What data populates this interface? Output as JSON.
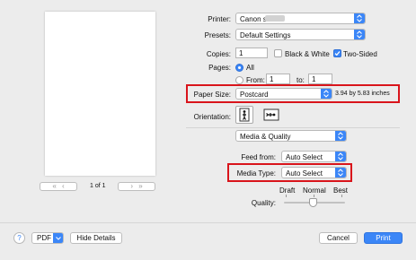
{
  "preview": {
    "page_counter": "1 of 1",
    "first_icon": "double-left-arrow",
    "prev_icon": "left-arrow",
    "next_icon": "right-arrow",
    "last_icon": "double-right-arrow"
  },
  "printer": {
    "label": "Printer:",
    "value": "Canon series"
  },
  "presets": {
    "label": "Presets:",
    "value": "Default Settings"
  },
  "copies": {
    "label": "Copies:",
    "value": "1",
    "black_white_label": "Black & White",
    "black_white_checked": false,
    "two_sided_label": "Two-Sided",
    "two_sided_checked": true
  },
  "pages": {
    "label": "Pages:",
    "all_label": "All",
    "all_selected": true,
    "from_label": "From:",
    "from_value": "1",
    "to_label": "to:",
    "to_value": "1"
  },
  "paper_size": {
    "label": "Paper Size:",
    "value": "Postcard",
    "dimensions": "3.94 by 5.83 inches"
  },
  "orientation": {
    "label": "Orientation:",
    "portrait_icon": "portrait-icon",
    "landscape_icon": "landscape-icon",
    "selected": "portrait"
  },
  "section_popup": {
    "value": "Media & Quality"
  },
  "feed_from": {
    "label": "Feed from:",
    "value": "Auto Select"
  },
  "media_type": {
    "label": "Media Type:",
    "value": "Auto Select"
  },
  "quality": {
    "label": "Quality:",
    "ticks": [
      "Draft",
      "Normal",
      "Best"
    ],
    "level": "Normal"
  },
  "footer": {
    "help_label": "?",
    "pdf_label": "PDF",
    "hide_details_label": "Hide Details",
    "cancel_label": "Cancel",
    "print_label": "Print"
  },
  "colors": {
    "accent": "#3b86f7",
    "highlight_box": "#d9141b"
  }
}
